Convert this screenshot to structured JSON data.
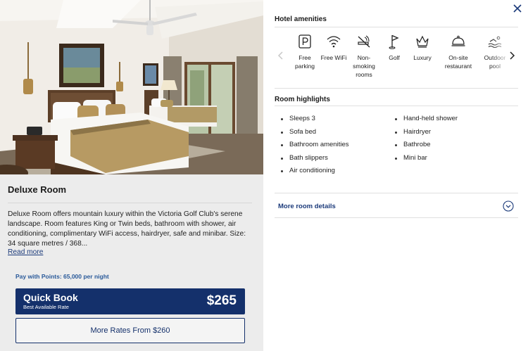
{
  "room": {
    "title": "Deluxe Room",
    "description": "Deluxe Room offers mountain luxury within the Victoria Golf Club's serene landscape. Room features King or Twin beds, bathroom with shower, air conditioning, complimentary WiFi access, hairdryer, safe and minibar. Size: 34 square metres / 368...",
    "read_more": "Read more"
  },
  "pricing": {
    "points_text": "Pay with Points: 65,000 per night",
    "quick_book": {
      "title": "Quick Book",
      "subtitle": "Best Available Rate",
      "price": "$265"
    },
    "more_rates": "More Rates From $260"
  },
  "amenities": {
    "title": "Hotel amenities",
    "items": [
      {
        "label": "Free parking",
        "icon": "parking-icon"
      },
      {
        "label": "Free WiFi",
        "icon": "wifi-icon"
      },
      {
        "label": "Non-smoking rooms",
        "icon": "no-smoking-icon"
      },
      {
        "label": "Golf",
        "icon": "golf-flag-icon"
      },
      {
        "label": "Luxury",
        "icon": "crown-icon"
      },
      {
        "label": "On-site restaurant",
        "icon": "cloche-icon"
      },
      {
        "label": "Outdoor pool",
        "icon": "swimmer-icon"
      }
    ]
  },
  "highlights": {
    "title": "Room highlights",
    "col1": [
      "Sleeps 3",
      "Sofa bed",
      "Bathroom amenities",
      "Bath slippers",
      "Air conditioning"
    ],
    "col2": [
      "Hand-held shower",
      "Hairdryer",
      "Bathrobe",
      "Mini bar"
    ]
  },
  "more_details": "More room details",
  "colors": {
    "navy": "#14306b",
    "link": "#1b3a7a",
    "panel_bg": "#ececec"
  }
}
